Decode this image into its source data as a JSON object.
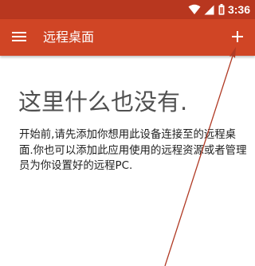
{
  "status_bar": {
    "time": "3:36",
    "icons": [
      "wifi-icon",
      "cellular-signal-icon",
      "battery-icon"
    ]
  },
  "app_bar": {
    "title": "远程桌面",
    "menu_icon": "hamburger-menu-icon",
    "add_icon": "plus-icon"
  },
  "empty_state": {
    "title": "这里什么也没有.",
    "description": "开始前,请先添加你想用此设备连接至的远程桌面.你也可以添加此应用使用的远程资源或者管理员为你设置好的远程PC."
  },
  "colors": {
    "status_bar": "#b8371f",
    "app_bar": "#d04525",
    "annotation_arrow": "#b03a24"
  }
}
